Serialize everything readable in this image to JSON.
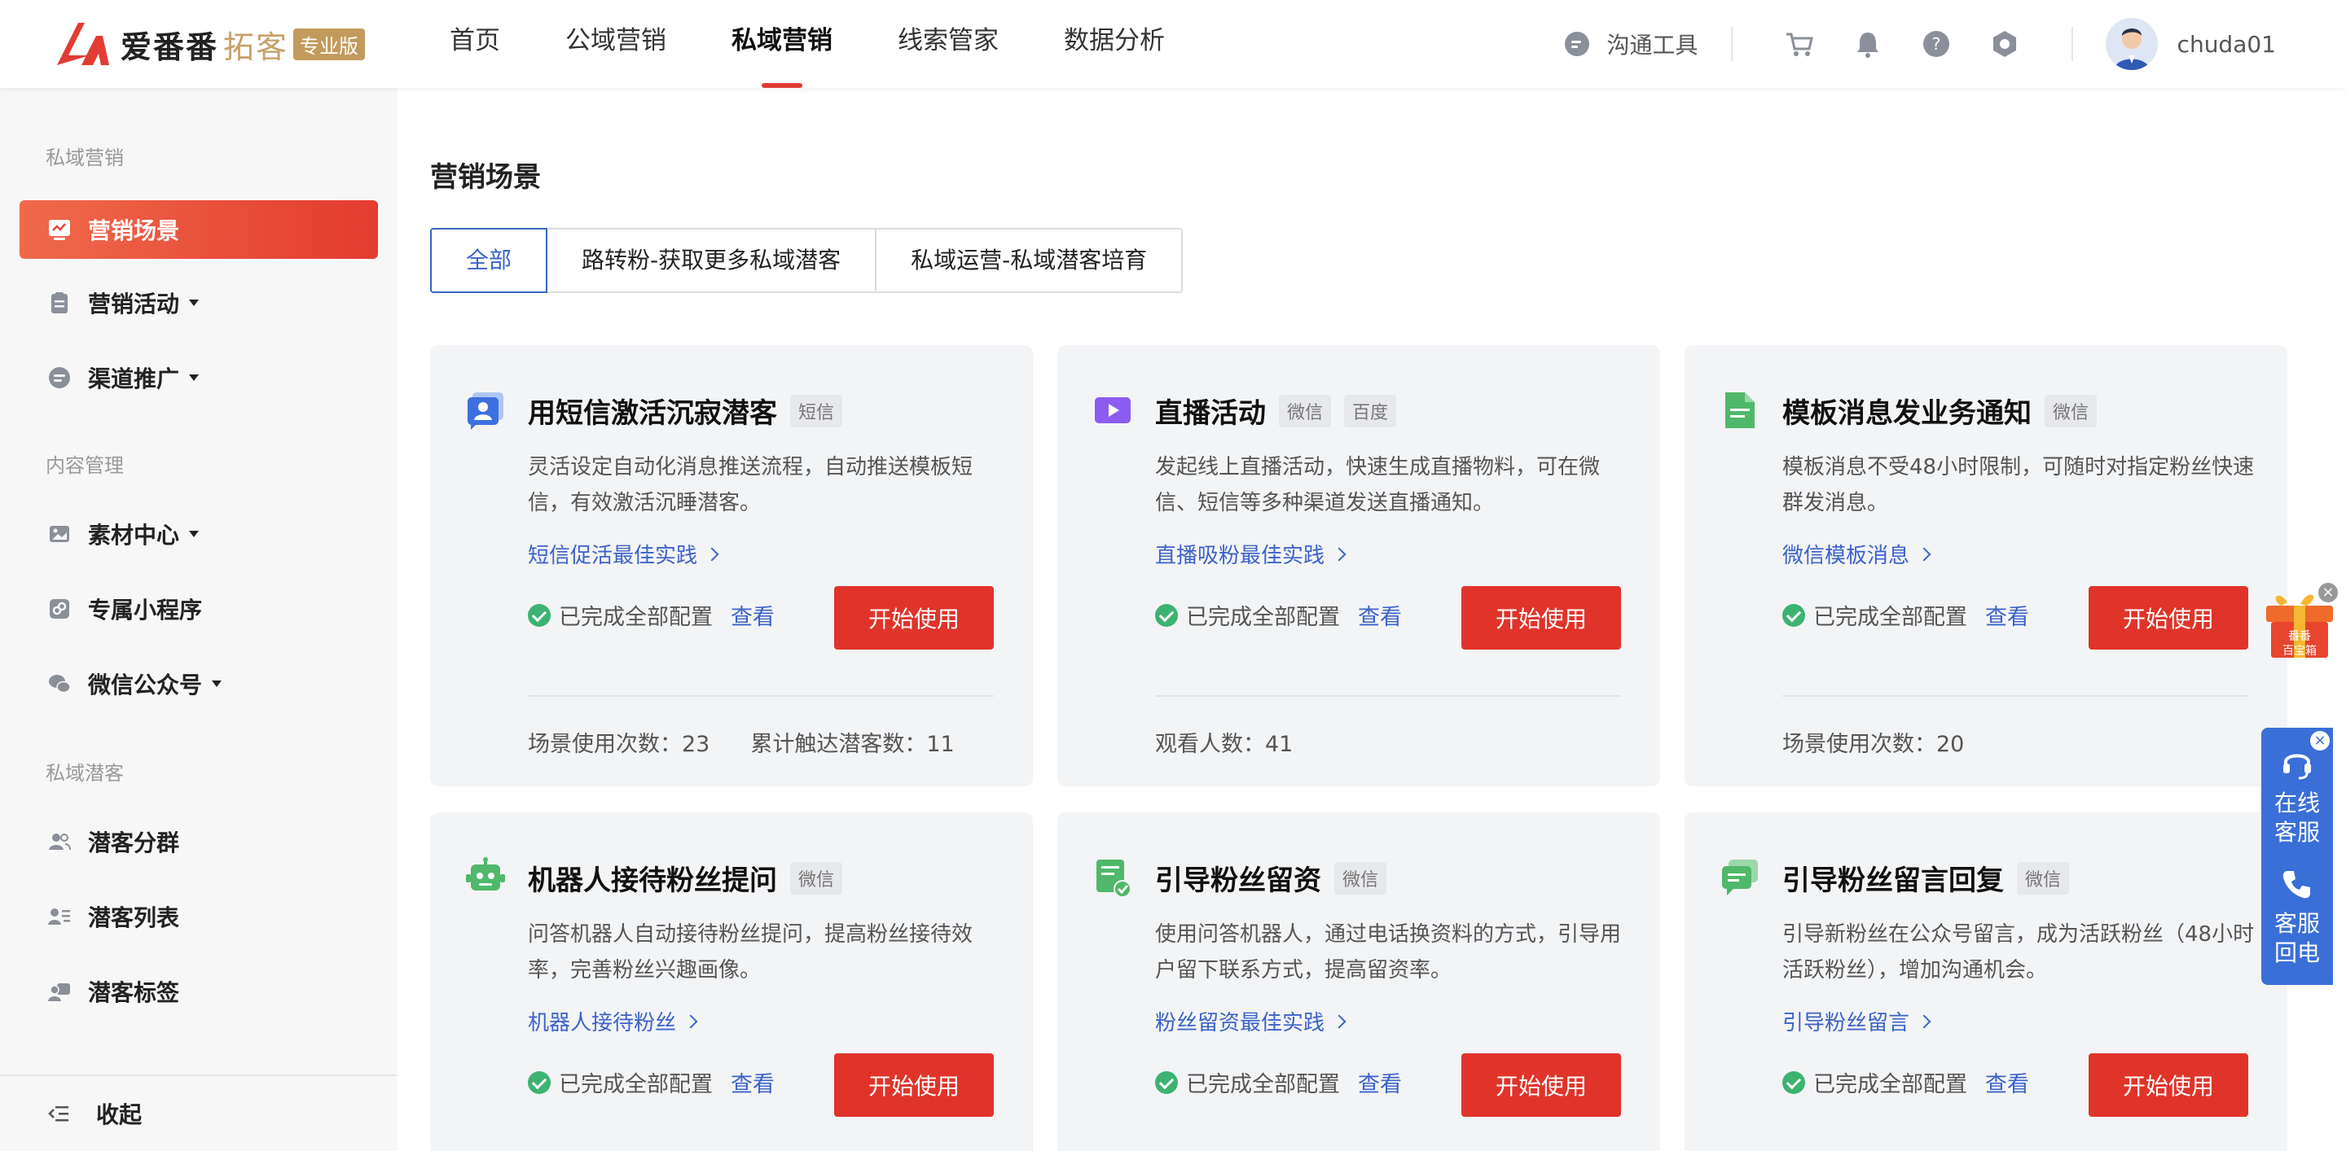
{
  "brand": {
    "name": "爱番番",
    "sub": "拓客",
    "badge": "专业版",
    "color": "#e23c33"
  },
  "nav": {
    "items": [
      "首页",
      "公域营销",
      "私域营销",
      "线索管家",
      "数据分析"
    ],
    "active": "私域营销"
  },
  "header": {
    "tool_label": "沟通工具",
    "username": "chuda01"
  },
  "sidebar": {
    "group1": "私域营销",
    "group2": "内容管理",
    "group3": "私域潜客",
    "items": {
      "scene": "营销场景",
      "activity": "营销活动",
      "channel": "渠道推广",
      "material": "素材中心",
      "miniapp": "专属小程序",
      "wechat": "微信公众号",
      "segment": "潜客分群",
      "list": "潜客列表",
      "tags": "潜客标签"
    },
    "collapse": "收起"
  },
  "main": {
    "title": "营销场景",
    "filters": [
      "全部",
      "路转粉-获取更多私域潜客",
      "私域运营-私域潜客培育"
    ],
    "status_text": "已完成全部配置",
    "view_text": "查看",
    "start_text": "开始使用",
    "cards": [
      {
        "title": "用短信激活沉寂潜客",
        "tags": [
          "短信"
        ],
        "desc": "灵活设定自动化消息推送流程，自动推送模板短信，有效激活沉睡潜客。",
        "link": "短信促活最佳实践",
        "stats": [
          "场景使用次数：23",
          "累计触达潜客数：11"
        ]
      },
      {
        "title": "直播活动",
        "tags": [
          "微信",
          "百度"
        ],
        "desc": "发起线上直播活动，快速生成直播物料，可在微信、短信等多种渠道发送直播通知。",
        "link": "直播吸粉最佳实践",
        "stats": [
          "观看人数：41"
        ]
      },
      {
        "title": "模板消息发业务通知",
        "tags": [
          "微信"
        ],
        "desc": "模板消息不受48小时限制，可随时对指定粉丝快速群发消息。",
        "link": "微信模板消息",
        "stats": [
          "场景使用次数：20"
        ]
      },
      {
        "title": "机器人接待粉丝提问",
        "tags": [
          "微信"
        ],
        "desc": "问答机器人自动接待粉丝提问，提高粉丝接待效率，完善粉丝兴趣画像。",
        "link": "机器人接待粉丝",
        "stats": []
      },
      {
        "title": "引导粉丝留资",
        "tags": [
          "微信"
        ],
        "desc": "使用问答机器人，通过电话换资料的方式，引导用户留下联系方式，提高留资率。",
        "link": "粉丝留资最佳实践",
        "stats": []
      },
      {
        "title": "引导粉丝留言回复",
        "tags": [
          "微信"
        ],
        "desc": "引导新粉丝在公众号留言，成为活跃粉丝（48小时活跃粉丝），增加沟通机会。",
        "link": "引导粉丝留言",
        "stats": []
      }
    ]
  },
  "float": {
    "gift_label1": "番番",
    "gift_label2": "百宝箱",
    "online_service": "在线客服",
    "callback": "客服回电",
    "close": "×"
  }
}
